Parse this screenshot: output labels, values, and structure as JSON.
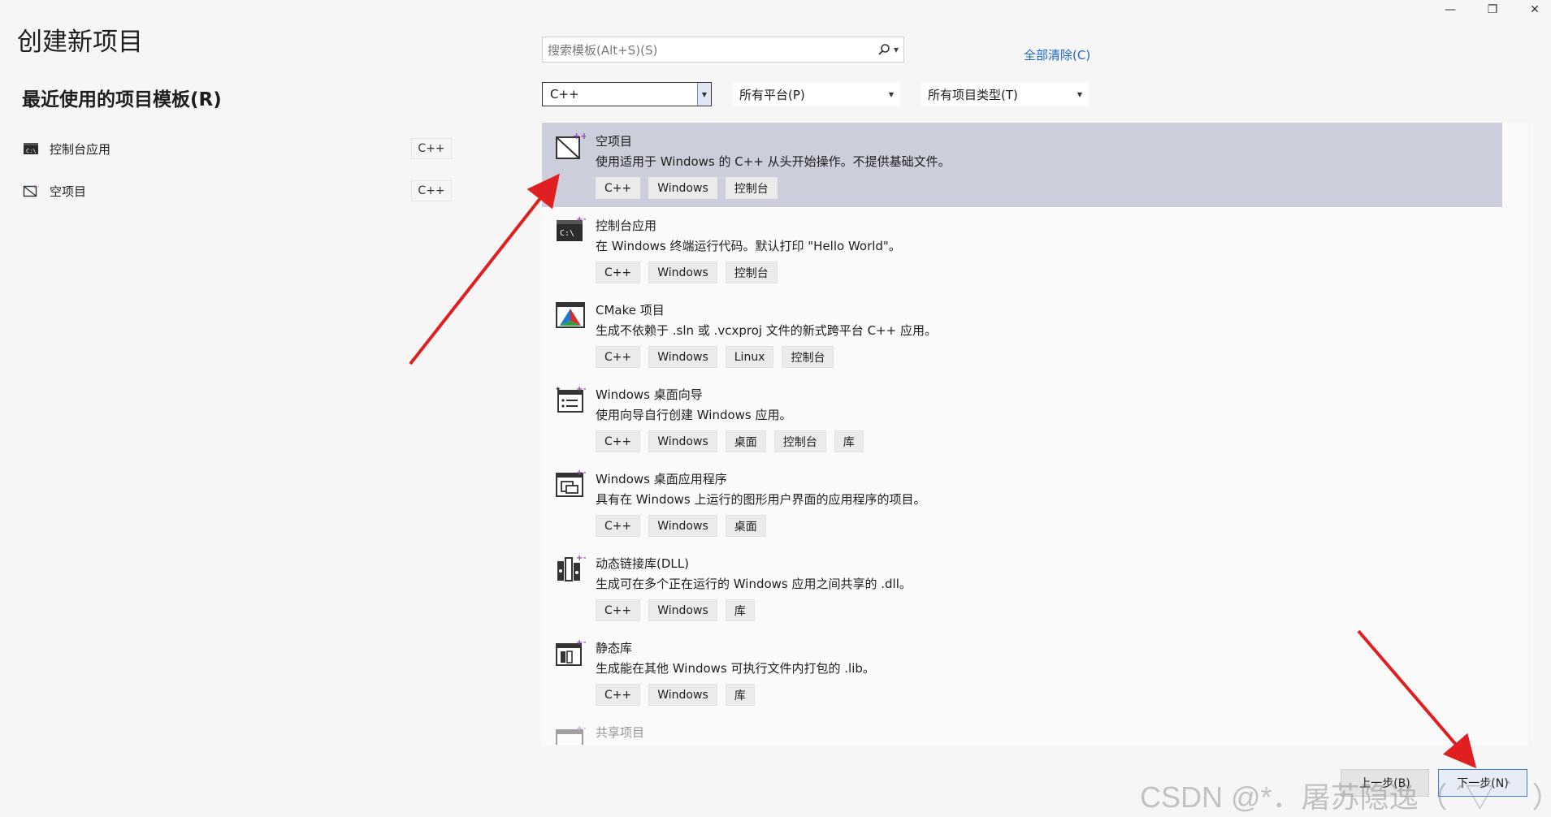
{
  "window_controls": {
    "minimize": "—",
    "restore": "❐",
    "close": "✕"
  },
  "page_title": "创建新项目",
  "recent": {
    "title": "最近使用的项目模板(R)",
    "items": [
      {
        "label": "控制台应用",
        "lang": "C++",
        "icon": "console-app-icon"
      },
      {
        "label": "空项目",
        "lang": "C++",
        "icon": "empty-project-icon"
      }
    ]
  },
  "search": {
    "placeholder": "搜索模板(Alt+S)(S)",
    "icon": "search-icon"
  },
  "clear_all": "全部清除(C)",
  "filters": {
    "language": "C++",
    "platform": "所有平台(P)",
    "project_type": "所有项目类型(T)"
  },
  "templates": [
    {
      "name": "空项目",
      "desc": "使用适用于 Windows 的 C++ 从头开始操作。不提供基础文件。",
      "tags": [
        "C++",
        "Windows",
        "控制台"
      ],
      "icon": "empty-project-icon",
      "selected": true
    },
    {
      "name": "控制台应用",
      "desc": "在 Windows 终端运行代码。默认打印 \"Hello World\"。",
      "tags": [
        "C++",
        "Windows",
        "控制台"
      ],
      "icon": "console-app-icon"
    },
    {
      "name": "CMake 项目",
      "desc": "生成不依赖于 .sln 或 .vcxproj 文件的新式跨平台 C++ 应用。",
      "tags": [
        "C++",
        "Windows",
        "Linux",
        "控制台"
      ],
      "icon": "cmake-icon"
    },
    {
      "name": "Windows 桌面向导",
      "desc": "使用向导自行创建 Windows 应用。",
      "tags": [
        "C++",
        "Windows",
        "桌面",
        "控制台",
        "库"
      ],
      "icon": "desktop-wizard-icon"
    },
    {
      "name": "Windows 桌面应用程序",
      "desc": "具有在 Windows 上运行的图形用户界面的应用程序的项目。",
      "tags": [
        "C++",
        "Windows",
        "桌面"
      ],
      "icon": "desktop-app-icon"
    },
    {
      "name": "动态链接库(DLL)",
      "desc": "生成可在多个正在运行的 Windows 应用之间共享的 .dll。",
      "tags": [
        "C++",
        "Windows",
        "库"
      ],
      "icon": "dll-icon"
    },
    {
      "name": "静态库",
      "desc": "生成能在其他 Windows 可执行文件内打包的 .lib。",
      "tags": [
        "C++",
        "Windows",
        "库"
      ],
      "icon": "static-lib-icon"
    },
    {
      "name": "共享项目",
      "desc": "",
      "tags": [],
      "icon": "shared-project-icon"
    }
  ],
  "buttons": {
    "back": "上一步(B)",
    "next": "下一步(N)"
  },
  "watermark": "CSDN @*．屠苏隐逸（ ´▽｀ ）*．",
  "colors": {
    "selected_row": "#cccedb",
    "link": "#1a66cc",
    "annotation_arrow": "#e02020"
  }
}
